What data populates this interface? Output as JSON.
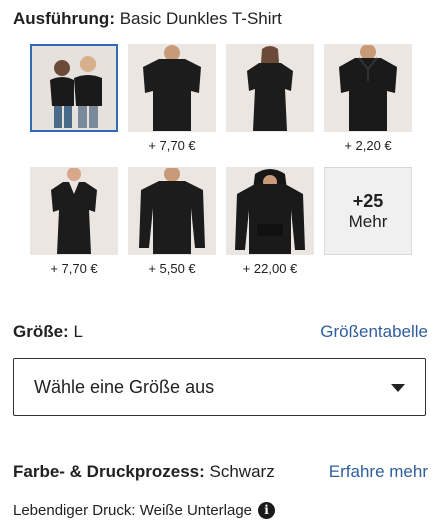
{
  "style": {
    "label": "Ausführung:",
    "value": "Basic Dunkles T-Shirt",
    "options": [
      {
        "name": "couple-shirt",
        "price": ""
      },
      {
        "name": "men-tshirt",
        "price": "+ 7,70 €"
      },
      {
        "name": "women-tshirt",
        "price": ""
      },
      {
        "name": "polo-shirt",
        "price": "+ 2,20 €"
      },
      {
        "name": "women-vneck",
        "price": "+ 7,70 €"
      },
      {
        "name": "longsleeve",
        "price": "+ 5,50 €"
      },
      {
        "name": "hoodie",
        "price": "+ 22,00 €"
      }
    ],
    "more_count": "+25",
    "more_label": "Mehr"
  },
  "size": {
    "label": "Größe:",
    "value": "L",
    "chart_link": "Größentabelle",
    "select_placeholder": "Wähle eine Größe aus"
  },
  "color": {
    "label": "Farbe- & Druckprozess:",
    "value": "Schwarz",
    "learn_more": "Erfahre mehr"
  },
  "print": {
    "text": "Lebendiger Druck: Weiße Unterlage",
    "info_icon": "i"
  }
}
